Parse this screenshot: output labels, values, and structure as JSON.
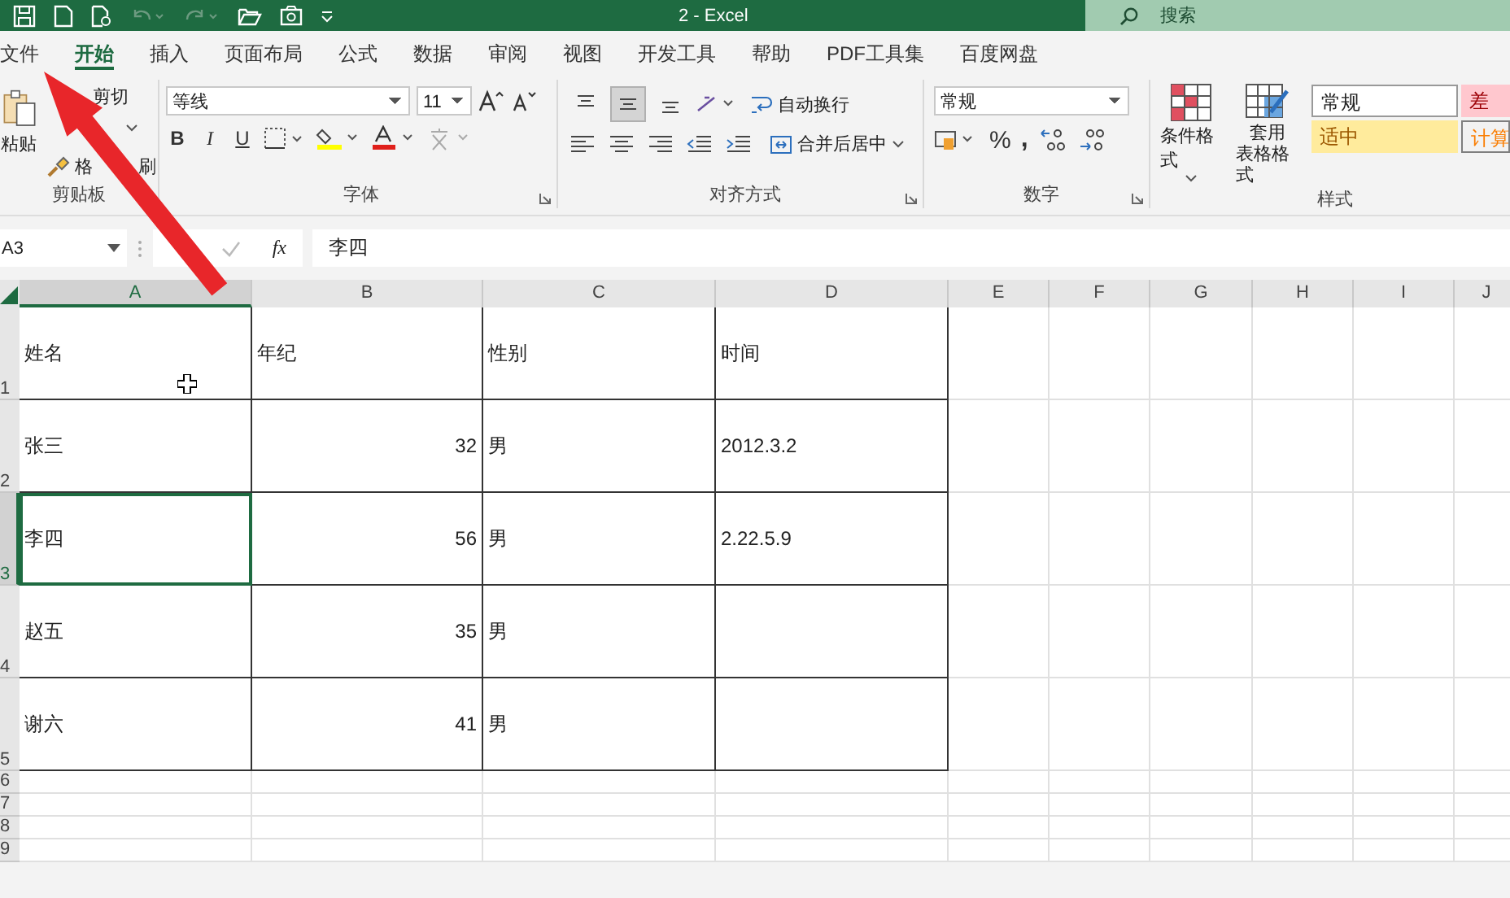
{
  "title_bar": {
    "title": "2  -  Excel",
    "search_placeholder": "搜索"
  },
  "menu_tabs": [
    {
      "label": "文件",
      "selected": false
    },
    {
      "label": "开始",
      "selected": true
    },
    {
      "label": "插入",
      "selected": false
    },
    {
      "label": "页面布局",
      "selected": false
    },
    {
      "label": "公式",
      "selected": false
    },
    {
      "label": "数据",
      "selected": false
    },
    {
      "label": "审阅",
      "selected": false
    },
    {
      "label": "视图",
      "selected": false
    },
    {
      "label": "开发工具",
      "selected": false
    },
    {
      "label": "帮助",
      "selected": false
    },
    {
      "label": "PDF工具集",
      "selected": false
    },
    {
      "label": "百度网盘",
      "selected": false
    }
  ],
  "ribbon": {
    "clipboard": {
      "label": "剪贴板",
      "paste": "粘贴",
      "cut": "剪切",
      "format_painter": [
        "格",
        "刷"
      ]
    },
    "font": {
      "label": "字体",
      "font_name": "等线",
      "font_size": "11",
      "bold": "B",
      "italic": "I",
      "underline": "U"
    },
    "alignment": {
      "label": "对齐方式",
      "wrap_text": "自动换行",
      "merge_center": "合并后居中",
      "vertical_align": [
        {
          "kind": "top",
          "selected": false
        },
        {
          "kind": "middle",
          "selected": true
        },
        {
          "kind": "bottom",
          "selected": false
        }
      ]
    },
    "number": {
      "label": "数字",
      "format": "常规",
      "percent": "%",
      "comma": ","
    },
    "styles": {
      "label": "样式",
      "conditional_format": "条件格式",
      "table_format": [
        "套用",
        "表格格式"
      ],
      "cell_styles": [
        {
          "label": "常规",
          "kind": "normal"
        },
        {
          "label": "差",
          "kind": "bad"
        },
        {
          "label": "适中",
          "kind": "neutral"
        },
        {
          "label": "计算",
          "kind": "calculation"
        }
      ]
    }
  },
  "formula_bar": {
    "name_box": "A3",
    "fx": "fx",
    "value": "李四"
  },
  "sheet": {
    "columns": [
      {
        "label": "A",
        "selected": true
      },
      {
        "label": "B",
        "selected": false
      },
      {
        "label": "C",
        "selected": false
      },
      {
        "label": "D",
        "selected": false
      },
      {
        "label": "E",
        "selected": false
      },
      {
        "label": "F",
        "selected": false
      },
      {
        "label": "G",
        "selected": false
      },
      {
        "label": "H",
        "selected": false
      },
      {
        "label": "I",
        "selected": false
      },
      {
        "label": "J",
        "selected": false
      }
    ],
    "rows": [
      {
        "label": "1",
        "selected": false,
        "cells": [
          {
            "text": "姓名",
            "kind": "text",
            "selected": false
          },
          {
            "text": "年纪",
            "kind": "text",
            "selected": false
          },
          {
            "text": "性别",
            "kind": "text",
            "selected": false
          },
          {
            "text": "时间",
            "kind": "text",
            "selected": false
          }
        ]
      },
      {
        "label": "2",
        "selected": false,
        "cells": [
          {
            "text": "张三",
            "kind": "text",
            "selected": false
          },
          {
            "text": "32",
            "kind": "number",
            "selected": false
          },
          {
            "text": "男",
            "kind": "text",
            "selected": false
          },
          {
            "text": "2012.3.2",
            "kind": "text",
            "selected": false
          }
        ]
      },
      {
        "label": "3",
        "selected": true,
        "cells": [
          {
            "text": "李四",
            "kind": "text",
            "selected": true
          },
          {
            "text": "56",
            "kind": "number",
            "selected": false
          },
          {
            "text": "男",
            "kind": "text",
            "selected": false
          },
          {
            "text": "2.22.5.9",
            "kind": "text",
            "selected": false
          }
        ]
      },
      {
        "label": "4",
        "selected": false,
        "cells": [
          {
            "text": "赵五",
            "kind": "text",
            "selected": false
          },
          {
            "text": "35",
            "kind": "number",
            "selected": false
          },
          {
            "text": "男",
            "kind": "text",
            "selected": false
          }
        ]
      },
      {
        "label": "5",
        "selected": false,
        "cells": [
          {
            "text": "谢六",
            "kind": "text",
            "selected": false
          },
          {
            "text": "41",
            "kind": "number",
            "selected": false
          },
          {
            "text": "男",
            "kind": "text",
            "selected": false
          }
        ]
      }
    ],
    "blank_rows": [
      "6",
      "7",
      "8",
      "9"
    ]
  }
}
